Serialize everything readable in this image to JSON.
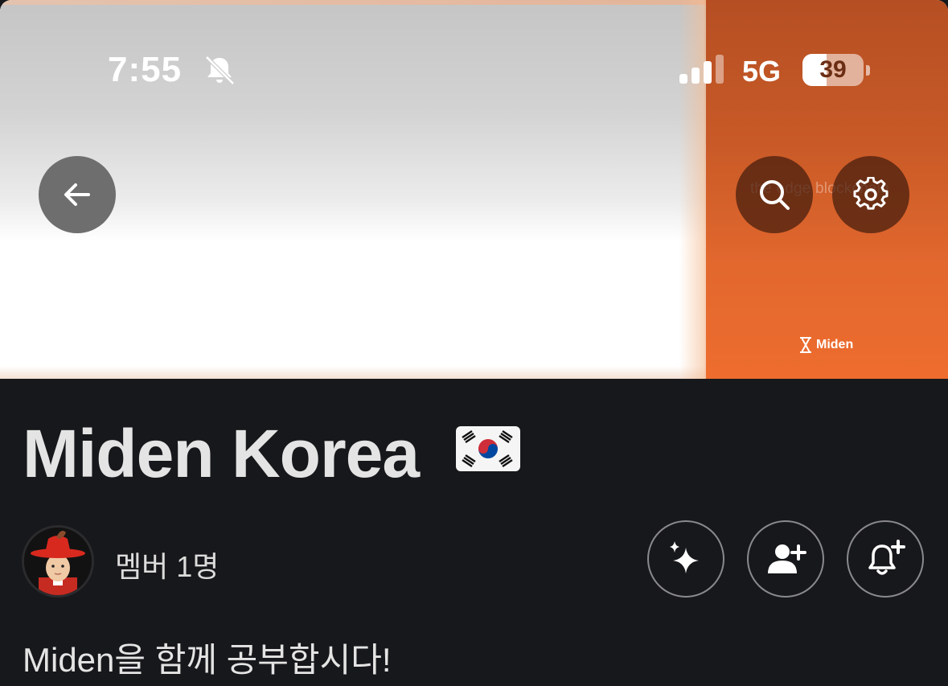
{
  "status_bar": {
    "time": "7:55",
    "silent_icon": "bell-slash-icon",
    "signal_icon": "cellular-signal-icon",
    "network": "5G",
    "battery_level": "39",
    "battery_fraction": 0.39
  },
  "banner": {
    "watermark_text": "the edge blockchain",
    "brand_text": "Miden",
    "colors": {
      "accent": "#ee6c2e"
    }
  },
  "nav": {
    "back_icon": "arrow-left-icon",
    "search_icon": "search-icon",
    "settings_icon": "gear-icon"
  },
  "community": {
    "title": "Miden Korea",
    "flag_icon": "south-korea-flag-icon",
    "member_count": "멤버 1명",
    "description": "Miden을 함께 공부합시다!"
  },
  "actions": [
    {
      "icon": "sparkles-icon"
    },
    {
      "icon": "add-person-icon"
    },
    {
      "icon": "bell-plus-icon"
    }
  ]
}
